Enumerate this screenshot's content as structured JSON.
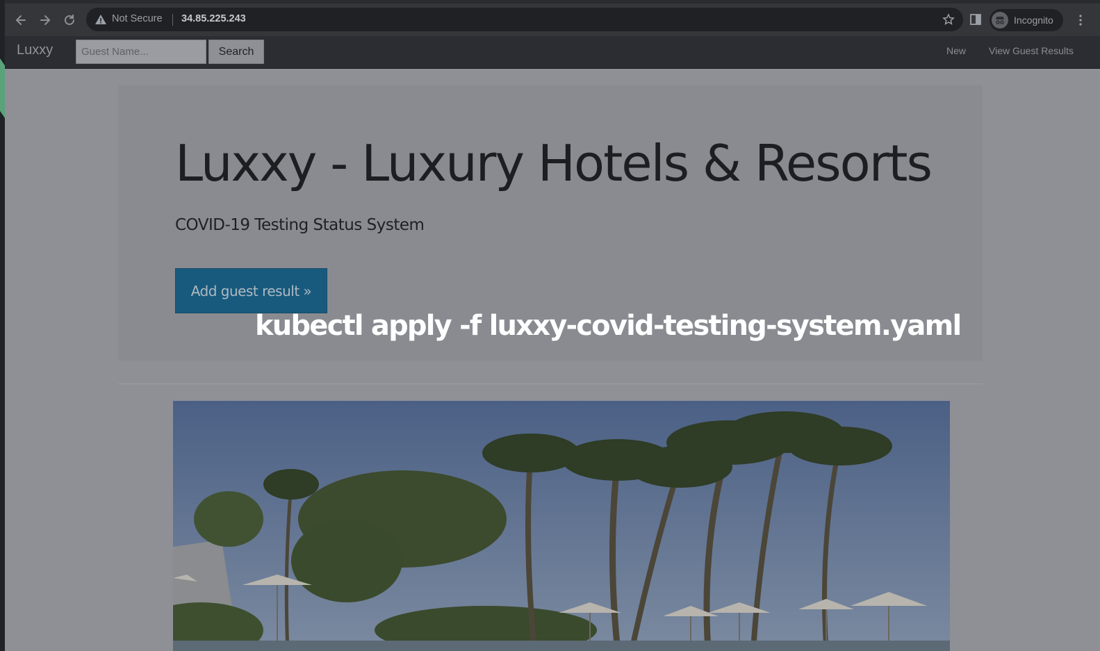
{
  "browser": {
    "security_label": "Not Secure",
    "url": "34.85.225.243",
    "profile_label": "Incognito"
  },
  "navbar": {
    "brand": "Luxxy",
    "search_placeholder": "Guest Name...",
    "search_label": "Search",
    "links": [
      {
        "label": "New"
      },
      {
        "label": "View Guest Results"
      }
    ]
  },
  "hero": {
    "title": "Luxxy - Luxury Hotels & Resorts",
    "subtitle": "COVID-19 Testing Status System",
    "cta_label": "Add guest result »"
  },
  "overlay": {
    "command": "kubectl apply -f luxxy-covid-testing-system.yaml"
  },
  "colors": {
    "cta": "#185a7d",
    "navbar": "#2b2d32",
    "page_dimmed": "#8e9096"
  },
  "icons": [
    "back-arrow-icon",
    "forward-arrow-icon",
    "reload-icon",
    "warning-icon",
    "star-icon",
    "side-panel-icon",
    "incognito-icon",
    "more-menu-icon"
  ]
}
